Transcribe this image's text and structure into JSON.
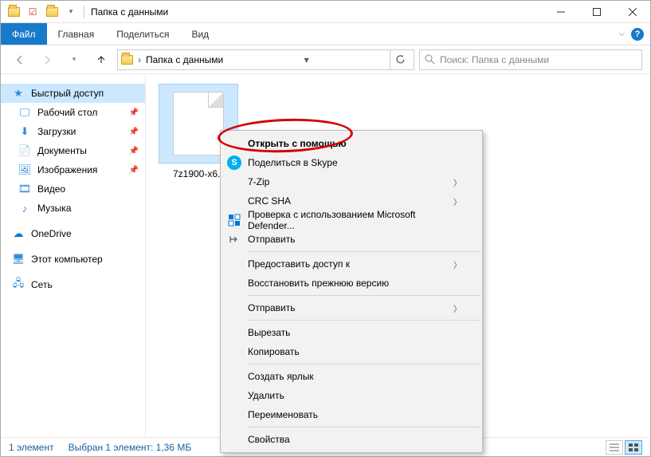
{
  "title": "Папка с данными",
  "ribbon": {
    "file": "Файл",
    "home": "Главная",
    "share": "Поделиться",
    "view": "Вид"
  },
  "address": {
    "path": "Папка с данными",
    "chevron": "›"
  },
  "search": {
    "placeholder": "Поиск: Папка с данными"
  },
  "sidebar": {
    "quick_access": "Быстрый доступ",
    "desktop": "Рабочий стол",
    "downloads": "Загрузки",
    "documents": "Документы",
    "pictures": "Изображения",
    "videos": "Видео",
    "music": "Музыка",
    "onedrive": "OneDrive",
    "this_pc": "Этот компьютер",
    "network": "Сеть"
  },
  "file": {
    "name": "7z1900-x6..."
  },
  "context_menu": {
    "open_with": "Открыть с помощью",
    "skype_share": "Поделиться в Skype",
    "seven_zip": "7-Zip",
    "crc_sha": "CRC SHA",
    "defender": "Проверка с использованием Microsoft Defender...",
    "send": "Отправить",
    "give_access": "Предоставить доступ к",
    "restore": "Восстановить прежнюю версию",
    "send_to": "Отправить",
    "cut": "Вырезать",
    "copy": "Копировать",
    "create_shortcut": "Создать ярлык",
    "delete": "Удалить",
    "rename": "Переименовать",
    "properties": "Свойства"
  },
  "status": {
    "count": "1 элемент",
    "selected": "Выбран 1 элемент: 1,36 МБ"
  }
}
